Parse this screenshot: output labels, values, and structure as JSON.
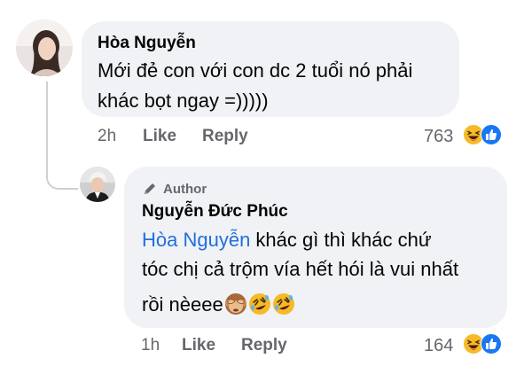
{
  "comment": {
    "author": "Hòa Nguyễn",
    "text_lines": [
      "Mới đẻ con với con dc 2 tuổi nó phải",
      "khác bọt ngay =)))))"
    ],
    "time": "2h",
    "like_label": "Like",
    "reply_label": "Reply",
    "reaction_count": "763",
    "reaction_icons": [
      "haha-icon",
      "like-icon"
    ]
  },
  "reply": {
    "badge": "Author",
    "author": "Nguyễn Đức Phúc",
    "mention": "Hòa Nguyễn",
    "text_line1_rest": " khác gì thì khác chứ",
    "text_line2": "tóc chị cả trộm vía hết hói là vui nhất",
    "text_line3": "rồi nèeee",
    "inline_emojis": [
      "see-no-evil-monkey-emoji",
      "rofl-emoji",
      "rofl-emoji"
    ],
    "time": "1h",
    "like_label": "Like",
    "reply_label": "Reply",
    "reaction_count": "164",
    "reaction_icons": [
      "haha-icon",
      "like-icon"
    ]
  },
  "colors": {
    "bubble": "#f0f2f5",
    "mention": "#216fdb",
    "meta": "#65676b",
    "like_blue": "#1877f2",
    "haha_yellow": "#f7b928"
  }
}
